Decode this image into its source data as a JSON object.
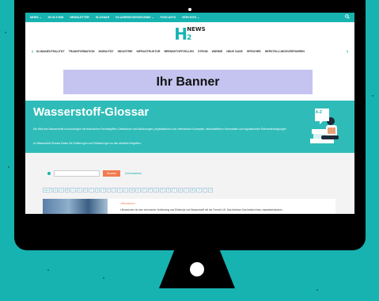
{
  "top_nav": {
    "items": [
      "NEWS ⌄",
      "H2 IN 5 MIN",
      "NEWSLETTER",
      "GLOSSAR",
      "H2-ADRESSVERZEICHNIS ⌄",
      "PODCASTS",
      "SERVICES ⌄"
    ],
    "search_icon": "search-icon"
  },
  "logo": {
    "h": "H",
    "two": "2",
    "news": "NEWS"
  },
  "categories": {
    "prev": "‹",
    "next": "›",
    "items": [
      "KLIMANEUTRALITÄT",
      "TRANSFORMATION",
      "MOBILITÄT",
      "INDUSTRIE",
      "INFRASTRUKTUR",
      "BRENNSTOFFZELLEN",
      "STROM",
      "WÄRME",
      "NEUE GASE",
      "SPEICHER",
      "HERSTELLUNGSVERFAHREN"
    ]
  },
  "banner": {
    "text": "Ihr Banner"
  },
  "glossar": {
    "title": "Wasserstoff-Glossar",
    "intro": "Die Welt des Wasserstoffs ist durchzogen mit technischen Fachbegriffen, Definitionen und Abkürzungen, physikalischen und chemischen Konzepten, wirtschaftlichen Kennzahlen und regulatorische Rahmenbedingungen.",
    "intro2": "Im Wasserstoff-Glossar finden Sie Erklärungen und Erläuterungen zu den aktuellen Begriffen.",
    "badge": "A-Z"
  },
  "search": {
    "button": "Suchen",
    "reset": "Zurücksetzen"
  },
  "alphabet": [
    "ALLE",
    "#",
    "A",
    "B",
    "C",
    "D",
    "E",
    "F",
    "G",
    "H",
    "I",
    "J",
    "K",
    "L",
    "M",
    "N",
    "O",
    "P",
    "Q",
    "R",
    "S",
    "T",
    "U",
    "V",
    "W",
    "X",
    "Y",
    "Z"
  ],
  "entry": {
    "title": "Lithiumionen",
    "text": "Lithiumionen ist eine chemische Verbindung aus Elektrolyt und Wasserstoff mit der Formel LiH. Das farblose Gas besitzt einen charakteristischen"
  },
  "colors": {
    "accent": "#17b3b0",
    "banner": "#c5c4f0",
    "button": "#f07b4f"
  }
}
